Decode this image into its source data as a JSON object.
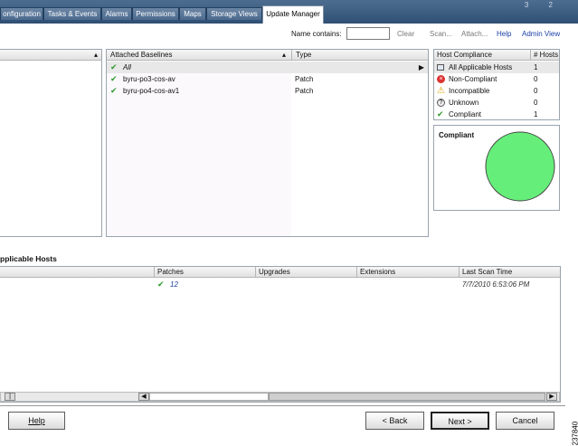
{
  "tabs": [
    {
      "label": "onfiguration"
    },
    {
      "label": "Tasks & Events"
    },
    {
      "label": "Alarms"
    },
    {
      "label": "Permissions"
    },
    {
      "label": "Maps"
    },
    {
      "label": "Storage Views"
    },
    {
      "label": "Update Manager"
    }
  ],
  "window_controls": "3 2",
  "toolbar": {
    "name_contains_label": "Name contains:",
    "name_contains_value": "",
    "clear": "Clear",
    "scan": "Scan...",
    "attach": "Attach...",
    "help": "Help",
    "admin_view": "Admin View"
  },
  "baselines": {
    "col_baselines": "Attached Baselines",
    "col_type": "Type",
    "rows": [
      {
        "name": "All",
        "type": ""
      },
      {
        "name": "byru-po3-cos-av",
        "type": "Patch"
      },
      {
        "name": "byru-po4-cos-av1",
        "type": "Patch"
      }
    ]
  },
  "compliance": {
    "col_host_compliance": "Host Compliance",
    "col_hosts": "# Hosts",
    "rows": [
      {
        "icon": "all-hosts-icon",
        "label": "All Applicable Hosts",
        "count": "1"
      },
      {
        "icon": "non-compliant-icon",
        "label": "Non-Compliant",
        "count": "0"
      },
      {
        "icon": "warning-icon",
        "label": "Incompatible",
        "count": "0"
      },
      {
        "icon": "unknown-icon",
        "label": "Unknown",
        "count": "0"
      },
      {
        "icon": "check-icon",
        "label": "Compliant",
        "count": "1"
      }
    ]
  },
  "chart_data": {
    "type": "pie",
    "title": "Compliant",
    "categories": [
      "Compliant"
    ],
    "values": [
      1
    ],
    "colors": [
      "#66ee7a"
    ]
  },
  "applicable_hosts": {
    "title": "pplicable Hosts",
    "columns": {
      "patches": "Patches",
      "upgrades": "Upgrades",
      "extensions": "Extensions",
      "last_scan": "Last Scan Time"
    },
    "rows": [
      {
        "patches": "12",
        "upgrades": "",
        "extensions": "",
        "last_scan": "7/7/2010 6:53:06 PM"
      }
    ]
  },
  "buttons": {
    "help": "Help",
    "back": "< Back",
    "next": "Next >",
    "cancel": "Cancel"
  },
  "figure_id": "237840",
  "colors": {
    "link": "#1a3fa6",
    "check": "#2e9a2e",
    "pie": "#66ee7a",
    "tabbar": "#2f4f74"
  }
}
